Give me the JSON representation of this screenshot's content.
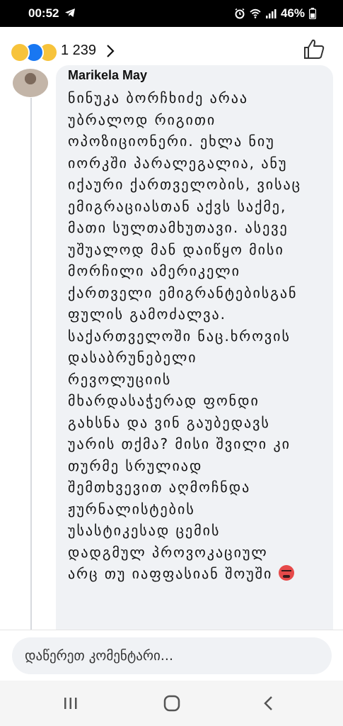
{
  "status": {
    "time": "00:52",
    "battery": "46%",
    "icons": [
      "telegram-icon",
      "alarm-icon",
      "wifi-icon",
      "signal-icon",
      "battery-icon"
    ]
  },
  "reactions": {
    "emojis": [
      "haha-emoji",
      "like-emoji",
      "wow-emoji"
    ],
    "count": "1 239"
  },
  "comment": {
    "author": "Marikela May",
    "lines": [
      "ნინუკა ბორჩხიძე არაა",
      "უბრალოდ რიგითი",
      "ოპოზიციონერი.  ეხლა ნიუ",
      "იორკში პარალეგალია, ანუ",
      "იქაური ქართველობის, ვისაც",
      "ემიგრაციასთან აქვს საქმე,",
      "მათი სულთამხუთავი. ასევე",
      "უშუალოდ მან დაიწყო მისი",
      "მორჩილი ამერიკელი",
      "ქართველი ემიგრანტებისგან",
      "ფულის გამოძალვა.",
      "საქართველოში ნაც.ხროვის",
      "დასაბრუნებელი",
      "რევოლუციის",
      "მხარდასაჭერად  ფონდი",
      "გახსნა და ვინ გაუბედავს",
      "უარის თქმა? მისი შვილი კი",
      "თურმე სრულიად",
      "შემთხვევით აღმოჩნდა",
      "ჟურნალისტების",
      "უსასტიკესად ცემის",
      "დადგმულ პროვოკაციულ",
      "არც თუ იაფფასიან შოუში"
    ],
    "end_emoji": "nauseated-face-emoji"
  },
  "composer": {
    "placeholder": "დაწერეთ კომენტარი..."
  },
  "colors": {
    "bubble": "#f0f2f5",
    "like_blue": "#1877f2",
    "haha_yellow": "#f7c33b"
  }
}
